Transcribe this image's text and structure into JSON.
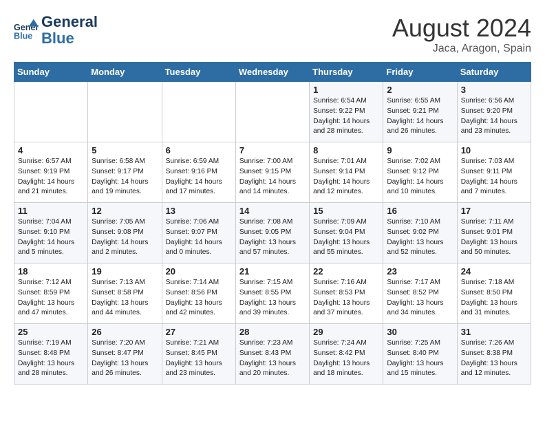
{
  "header": {
    "logo_line1": "General",
    "logo_line2": "Blue",
    "month_year": "August 2024",
    "location": "Jaca, Aragon, Spain"
  },
  "weekdays": [
    "Sunday",
    "Monday",
    "Tuesday",
    "Wednesday",
    "Thursday",
    "Friday",
    "Saturday"
  ],
  "weeks": [
    [
      {
        "day": "",
        "info": ""
      },
      {
        "day": "",
        "info": ""
      },
      {
        "day": "",
        "info": ""
      },
      {
        "day": "",
        "info": ""
      },
      {
        "day": "1",
        "info": "Sunrise: 6:54 AM\nSunset: 9:22 PM\nDaylight: 14 hours\nand 28 minutes."
      },
      {
        "day": "2",
        "info": "Sunrise: 6:55 AM\nSunset: 9:21 PM\nDaylight: 14 hours\nand 26 minutes."
      },
      {
        "day": "3",
        "info": "Sunrise: 6:56 AM\nSunset: 9:20 PM\nDaylight: 14 hours\nand 23 minutes."
      }
    ],
    [
      {
        "day": "4",
        "info": "Sunrise: 6:57 AM\nSunset: 9:19 PM\nDaylight: 14 hours\nand 21 minutes."
      },
      {
        "day": "5",
        "info": "Sunrise: 6:58 AM\nSunset: 9:17 PM\nDaylight: 14 hours\nand 19 minutes."
      },
      {
        "day": "6",
        "info": "Sunrise: 6:59 AM\nSunset: 9:16 PM\nDaylight: 14 hours\nand 17 minutes."
      },
      {
        "day": "7",
        "info": "Sunrise: 7:00 AM\nSunset: 9:15 PM\nDaylight: 14 hours\nand 14 minutes."
      },
      {
        "day": "8",
        "info": "Sunrise: 7:01 AM\nSunset: 9:14 PM\nDaylight: 14 hours\nand 12 minutes."
      },
      {
        "day": "9",
        "info": "Sunrise: 7:02 AM\nSunset: 9:12 PM\nDaylight: 14 hours\nand 10 minutes."
      },
      {
        "day": "10",
        "info": "Sunrise: 7:03 AM\nSunset: 9:11 PM\nDaylight: 14 hours\nand 7 minutes."
      }
    ],
    [
      {
        "day": "11",
        "info": "Sunrise: 7:04 AM\nSunset: 9:10 PM\nDaylight: 14 hours\nand 5 minutes."
      },
      {
        "day": "12",
        "info": "Sunrise: 7:05 AM\nSunset: 9:08 PM\nDaylight: 14 hours\nand 2 minutes."
      },
      {
        "day": "13",
        "info": "Sunrise: 7:06 AM\nSunset: 9:07 PM\nDaylight: 14 hours\nand 0 minutes."
      },
      {
        "day": "14",
        "info": "Sunrise: 7:08 AM\nSunset: 9:05 PM\nDaylight: 13 hours\nand 57 minutes."
      },
      {
        "day": "15",
        "info": "Sunrise: 7:09 AM\nSunset: 9:04 PM\nDaylight: 13 hours\nand 55 minutes."
      },
      {
        "day": "16",
        "info": "Sunrise: 7:10 AM\nSunset: 9:02 PM\nDaylight: 13 hours\nand 52 minutes."
      },
      {
        "day": "17",
        "info": "Sunrise: 7:11 AM\nSunset: 9:01 PM\nDaylight: 13 hours\nand 50 minutes."
      }
    ],
    [
      {
        "day": "18",
        "info": "Sunrise: 7:12 AM\nSunset: 8:59 PM\nDaylight: 13 hours\nand 47 minutes."
      },
      {
        "day": "19",
        "info": "Sunrise: 7:13 AM\nSunset: 8:58 PM\nDaylight: 13 hours\nand 44 minutes."
      },
      {
        "day": "20",
        "info": "Sunrise: 7:14 AM\nSunset: 8:56 PM\nDaylight: 13 hours\nand 42 minutes."
      },
      {
        "day": "21",
        "info": "Sunrise: 7:15 AM\nSunset: 8:55 PM\nDaylight: 13 hours\nand 39 minutes."
      },
      {
        "day": "22",
        "info": "Sunrise: 7:16 AM\nSunset: 8:53 PM\nDaylight: 13 hours\nand 37 minutes."
      },
      {
        "day": "23",
        "info": "Sunrise: 7:17 AM\nSunset: 8:52 PM\nDaylight: 13 hours\nand 34 minutes."
      },
      {
        "day": "24",
        "info": "Sunrise: 7:18 AM\nSunset: 8:50 PM\nDaylight: 13 hours\nand 31 minutes."
      }
    ],
    [
      {
        "day": "25",
        "info": "Sunrise: 7:19 AM\nSunset: 8:48 PM\nDaylight: 13 hours\nand 28 minutes."
      },
      {
        "day": "26",
        "info": "Sunrise: 7:20 AM\nSunset: 8:47 PM\nDaylight: 13 hours\nand 26 minutes."
      },
      {
        "day": "27",
        "info": "Sunrise: 7:21 AM\nSunset: 8:45 PM\nDaylight: 13 hours\nand 23 minutes."
      },
      {
        "day": "28",
        "info": "Sunrise: 7:23 AM\nSunset: 8:43 PM\nDaylight: 13 hours\nand 20 minutes."
      },
      {
        "day": "29",
        "info": "Sunrise: 7:24 AM\nSunset: 8:42 PM\nDaylight: 13 hours\nand 18 minutes."
      },
      {
        "day": "30",
        "info": "Sunrise: 7:25 AM\nSunset: 8:40 PM\nDaylight: 13 hours\nand 15 minutes."
      },
      {
        "day": "31",
        "info": "Sunrise: 7:26 AM\nSunset: 8:38 PM\nDaylight: 13 hours\nand 12 minutes."
      }
    ]
  ]
}
